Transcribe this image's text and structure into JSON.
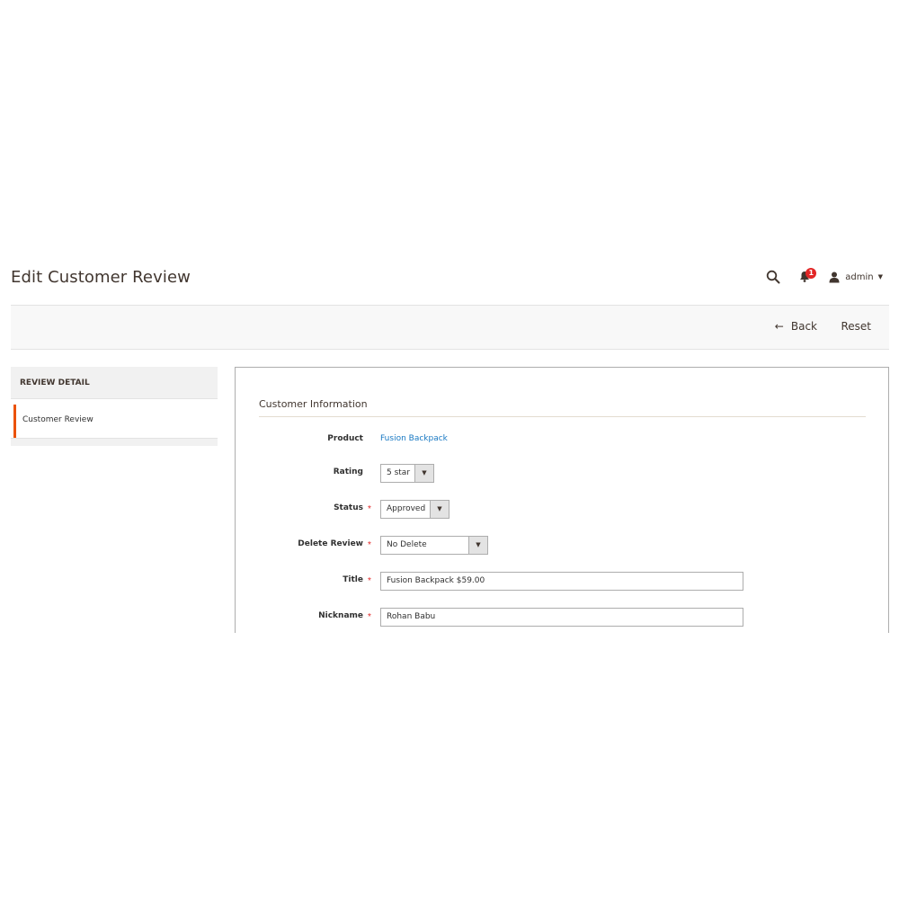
{
  "header": {
    "title": "Edit Customer Review",
    "notification_count": "1",
    "user_name": "admin",
    "icons": [
      "search-icon",
      "bell-icon",
      "user-icon",
      "caret-down-icon"
    ]
  },
  "toolbar": {
    "back_label": "Back",
    "reset_label": "Reset"
  },
  "sidebar": {
    "title": "REVIEW DETAIL",
    "items": [
      {
        "label": "Customer Review",
        "active": true
      }
    ]
  },
  "form": {
    "section_title": "Customer Information",
    "product": {
      "label": "Product",
      "value": "Fusion Backpack"
    },
    "rating": {
      "label": "Rating",
      "value": "5 star"
    },
    "status": {
      "label": "Status",
      "value": "Approved",
      "required": true
    },
    "delete_review": {
      "label": "Delete Review",
      "value": "No Delete",
      "required": true
    },
    "title": {
      "label": "Title",
      "value": "Fusion Backpack $59.00",
      "required": true
    },
    "nickname": {
      "label": "Nickname",
      "value": "Rohan Babu",
      "required": true
    }
  },
  "colors": {
    "accent": "#eb5202",
    "link": "#1979c3",
    "required": "#e22626",
    "badge": "#e22626"
  }
}
